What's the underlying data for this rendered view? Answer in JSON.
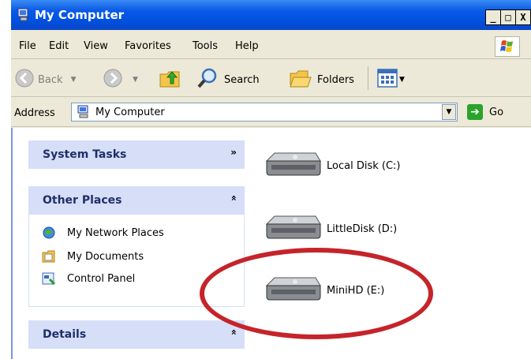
{
  "window": {
    "title": "My Computer",
    "buttons": {
      "minimize": "_",
      "maximize": "□",
      "close": "X"
    }
  },
  "menu": [
    "File",
    "Edit",
    "View",
    "Favorites",
    "Tools",
    "Help"
  ],
  "toolbar": {
    "back_label": "Back",
    "search_label": "Search",
    "folders_label": "Folders"
  },
  "address": {
    "label": "Address",
    "value": "My Computer",
    "go_label": "Go"
  },
  "tasks": {
    "system_tasks": "System Tasks",
    "other_places": {
      "title": "Other Places",
      "items": [
        "My Network Places",
        "My Documents",
        "Control Panel"
      ]
    },
    "details": "Details"
  },
  "drives": [
    "Local Disk (C:)",
    "LittleDisk (D:)",
    "MiniHD (E:)"
  ],
  "colors": {
    "titlebar": "#0050e0",
    "chrome": "#ece9d8",
    "panel_header": "#d6dff7",
    "highlight_oval": "#c4242a"
  }
}
